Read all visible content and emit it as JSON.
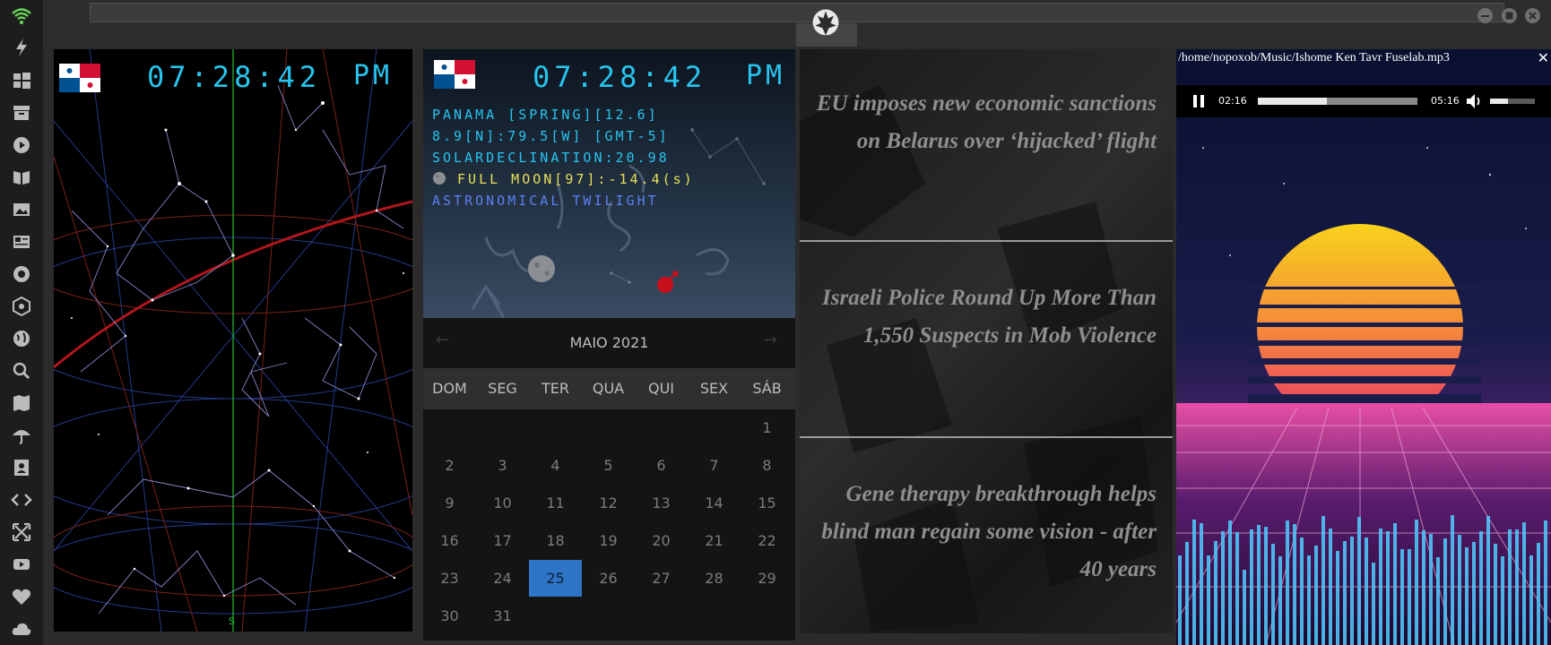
{
  "clock_left": {
    "time": "07:28:42",
    "ampm": "PM"
  },
  "clock_middle": {
    "time": "07:28:42",
    "ampm": "PM"
  },
  "info_lines": {
    "line1": "PANAMA [SPRING][12.6]",
    "line2": "8.9[N]:79.5[W] [GMT-5]",
    "line3": "SOLARDECLINATION:20.98",
    "line4": "FULL MOON[97]:-14.4(s)",
    "line5": "ASTRONOMICAL TWILIGHT"
  },
  "sky": {
    "compass_label": "S"
  },
  "calendar": {
    "month": "MAIO 2021",
    "prev": "←",
    "next": "→",
    "weekdays": [
      "DOM",
      "SEG",
      "TER",
      "QUA",
      "QUI",
      "SEX",
      "SÁB"
    ],
    "selected_day": "25",
    "days": [
      "1",
      "2",
      "3",
      "4",
      "5",
      "6",
      "7",
      "8",
      "9",
      "10",
      "11",
      "12",
      "13",
      "14",
      "15",
      "16",
      "17",
      "18",
      "19",
      "20",
      "21",
      "22",
      "23",
      "24",
      "25",
      "26",
      "27",
      "28",
      "29",
      "30",
      "31"
    ]
  },
  "news": [
    "EU imposes new economic sanctions on Belarus over ‘hijacked’ flight",
    "Israeli Police Round Up More Than 1,550 Suspects in Mob Violence",
    "Gene therapy breakthrough helps blind man regain some vision - after 40 years"
  ],
  "player": {
    "path": "/home/nopoxob/Music/Ishome Ken Tavr Fuselab.mp3",
    "close": "✕",
    "current": "02:16",
    "duration": "05:16",
    "progress": 0.43,
    "volume": 0.4
  },
  "colors": {
    "clock": "#27c4ee",
    "moon_text": "#e8e05a",
    "twilight_text": "#5c7ff0",
    "selected_day_bg": "#2e75c7"
  },
  "sidebar_icons": [
    "wifi-icon",
    "flash-icon",
    "windows-icon",
    "archive-icon",
    "play-icon",
    "book-icon",
    "image-icon",
    "news-icon",
    "aperture-icon",
    "hexagon-icon",
    "globe-icon",
    "search-icon",
    "map-icon",
    "umbrella-icon",
    "contact-icon",
    "code-icon",
    "expand-icon",
    "youtube-icon",
    "heart-icon",
    "cloud-icon"
  ]
}
